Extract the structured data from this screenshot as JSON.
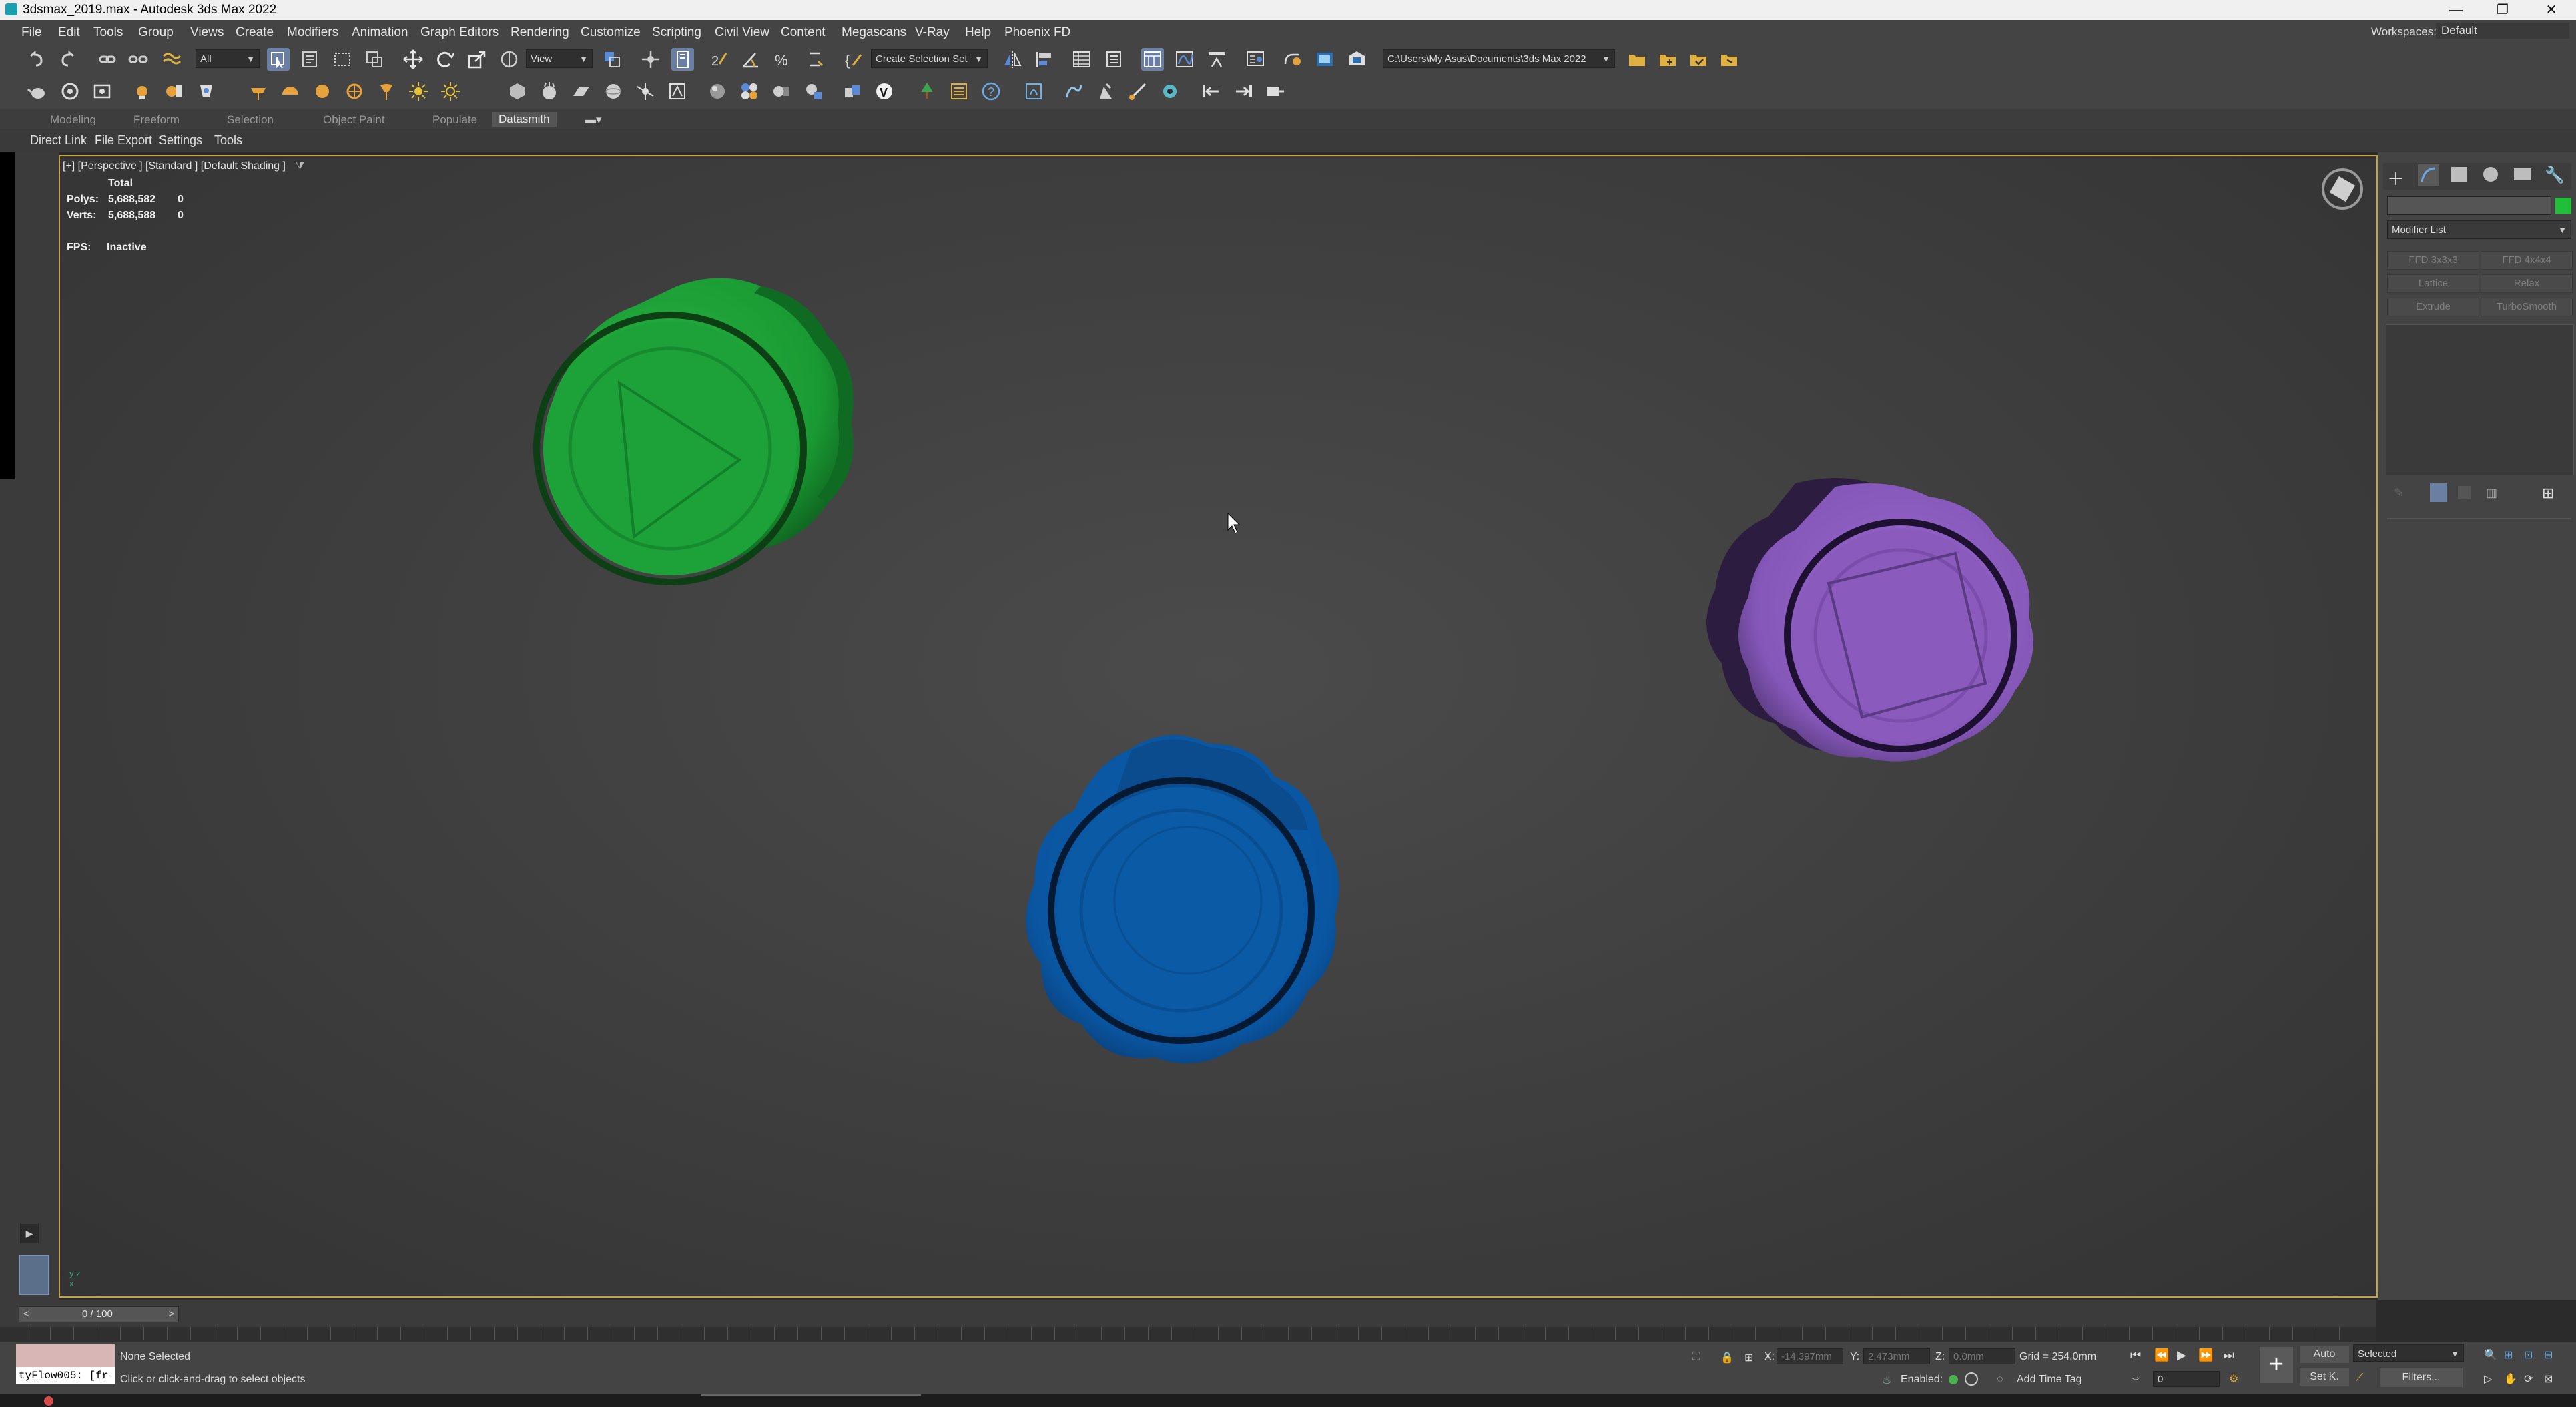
{
  "window": {
    "title": "3dsmax_2019.max - Autodesk 3ds Max 2022",
    "minimize_glyph": "—",
    "restore_glyph": "❐",
    "close_glyph": "✕"
  },
  "menu": {
    "items": [
      "File",
      "Edit",
      "Tools",
      "Group",
      "Views",
      "Create",
      "Modifiers",
      "Animation",
      "Graph Editors",
      "Rendering",
      "Customize",
      "Scripting",
      "Civil View",
      "Content",
      "Megascans",
      "V-Ray",
      "Help",
      "Phoenix FD"
    ],
    "workspaces_label": "Workspaces:",
    "workspaces_value": "Default"
  },
  "toolbar": {
    "filter_value": "All",
    "refcoord_value": "View",
    "selection_set_value": "Create Selection Set",
    "project_path": "C:\\Users\\My Asus\\Documents\\3ds Max 2022"
  },
  "ribbon": {
    "tabs": [
      "Modeling",
      "Freeform",
      "Selection",
      "Object Paint",
      "Populate",
      "Datasmith"
    ],
    "active_tab": "Datasmith",
    "subtabs": [
      "Direct Link",
      "File Export",
      "Settings",
      "Tools"
    ]
  },
  "viewport": {
    "label": "[+] [Perspective ] [Standard ] [Default Shading ]",
    "stats": {
      "total_label": "Total",
      "polys_label": "Polys:",
      "polys_value": "5,688,582",
      "polys_sel": "0",
      "verts_label": "Verts:",
      "verts_value": "5,688,588",
      "verts_sel": "0",
      "fps_label": "FPS:",
      "fps_value": "Inactive"
    },
    "objects": [
      {
        "name": "green-play-knob",
        "color": "#1c9a34"
      },
      {
        "name": "purple-stop-knob",
        "color": "#8a5bbd"
      },
      {
        "name": "blue-knob",
        "color": "#0a5aa5"
      }
    ]
  },
  "command_panel": {
    "modifier_list": "Modifier List",
    "object_color": "#1fbf3a",
    "buttons": [
      "FFD 3x3x3",
      "FFD 4x4x4",
      "Lattice",
      "Relax",
      "Extrude",
      "TurboSmooth"
    ]
  },
  "timeline": {
    "frame_display": "0 / 100",
    "prev": "<",
    "next": ">"
  },
  "status": {
    "script_listener": "tyFlow005: [fr",
    "selection": "None Selected",
    "prompt": "Click or click-and-drag to select objects",
    "x_label": "X:",
    "x_value": "-14.397mm",
    "y_label": "Y:",
    "y_value": "2.473mm",
    "z_label": "Z:",
    "z_value": "0.0mm",
    "grid": "Grid = 254.0mm",
    "enabled_label": "Enabled:",
    "add_time_tag": "Add Time Tag",
    "auto_key": "Auto",
    "set_key": "Set K.",
    "key_filter_value": "Selected",
    "filters": "Filters...",
    "frame_value": "0"
  }
}
